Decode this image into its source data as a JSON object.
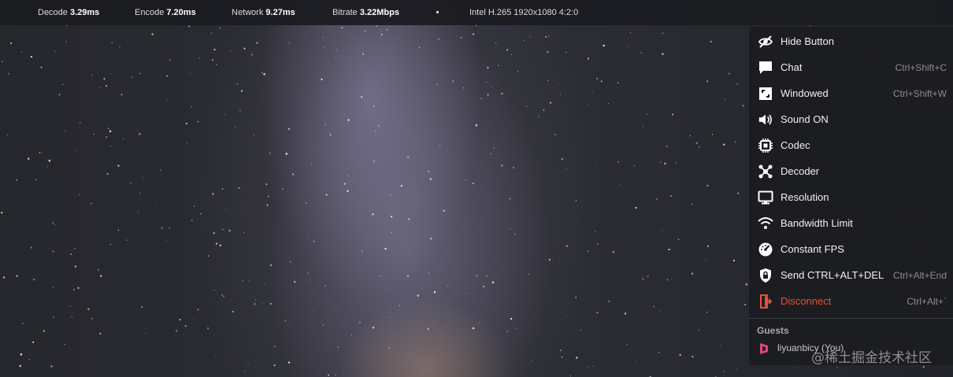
{
  "stats": {
    "decode": {
      "label": "Decode",
      "value": "3.29ms"
    },
    "encode": {
      "label": "Encode",
      "value": "7.20ms"
    },
    "network": {
      "label": "Network",
      "value": "9.27ms"
    },
    "bitrate": {
      "label": "Bitrate",
      "value": "3.22Mbps"
    },
    "codec_info": "Intel H.265 1920x1080 4:2:0"
  },
  "menu": {
    "items": [
      {
        "label": "Hide Button",
        "shortcut": "",
        "icon": "eye-slash-icon"
      },
      {
        "label": "Chat",
        "shortcut": "Ctrl+Shift+C",
        "icon": "chat-icon"
      },
      {
        "label": "Windowed",
        "shortcut": "Ctrl+Shift+W",
        "icon": "windowed-icon"
      },
      {
        "label": "Sound ON",
        "shortcut": "",
        "icon": "speaker-icon"
      },
      {
        "label": "Codec",
        "shortcut": "",
        "icon": "chip-icon"
      },
      {
        "label": "Decoder",
        "shortcut": "",
        "icon": "decoder-icon"
      },
      {
        "label": "Resolution",
        "shortcut": "",
        "icon": "monitor-icon"
      },
      {
        "label": "Bandwidth Limit",
        "shortcut": "",
        "icon": "wifi-icon"
      },
      {
        "label": "Constant FPS",
        "shortcut": "",
        "icon": "gauge-icon"
      },
      {
        "label": "Send CTRL+ALT+DEL",
        "shortcut": "Ctrl+Alt+End",
        "icon": "lock-icon"
      },
      {
        "label": "Disconnect",
        "shortcut": "Ctrl+Alt+`",
        "icon": "disconnect-icon"
      }
    ],
    "guests_title": "Guests",
    "guest_name": "liyuanbicy (You)"
  },
  "watermark": "@稀土掘金技术社区",
  "colors": {
    "danger": "#e8503c",
    "menu_bg": "#1c1d21",
    "guest_icon": "#e0457b"
  }
}
